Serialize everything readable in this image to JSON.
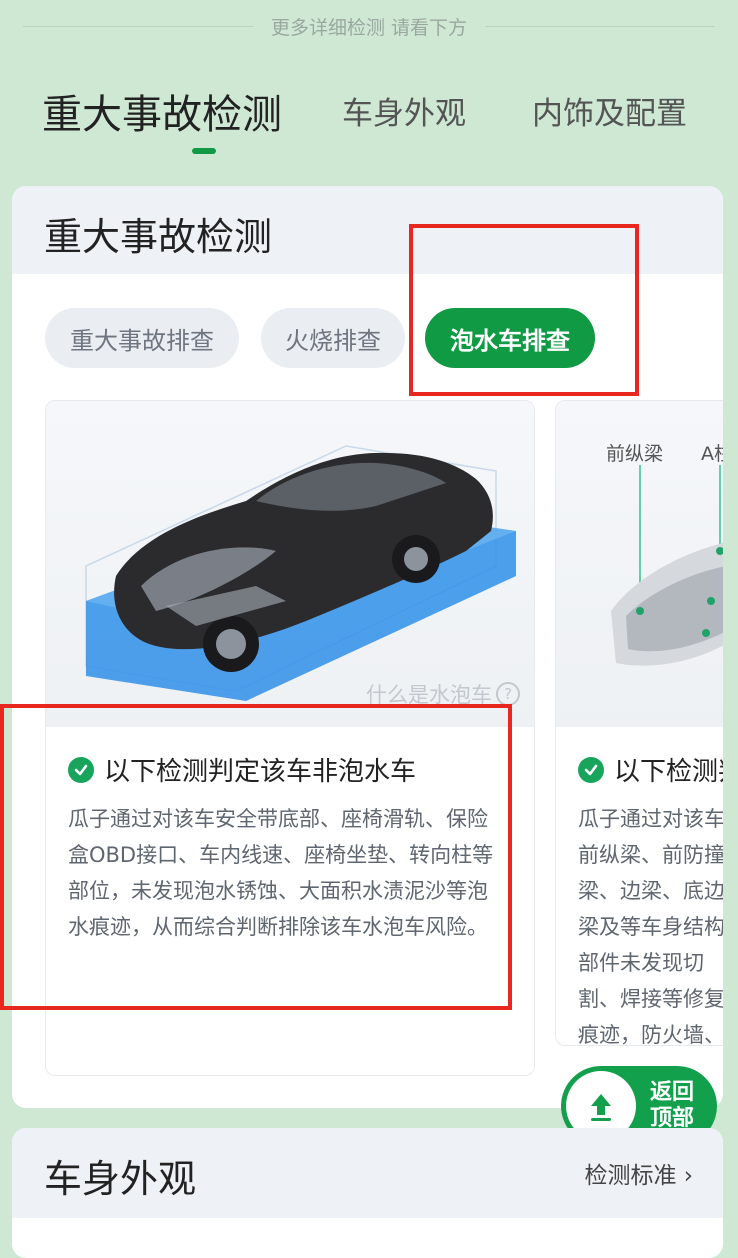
{
  "divider": {
    "text": "更多详细检测 请看下方"
  },
  "top_tabs": [
    {
      "label": "重大事故检测"
    },
    {
      "label": "车身外观"
    },
    {
      "label": "内饰及配置"
    }
  ],
  "section": {
    "title": "重大事故检测",
    "pills": [
      {
        "label": "重大事故排查"
      },
      {
        "label": "火烧排查"
      },
      {
        "label": "泡水车排查"
      }
    ],
    "flood_panel": {
      "help_link": "什么是水泡车",
      "result_title": "以下检测判定该车非泡水车",
      "description": "瓜子通过对该车安全带底部、座椅滑轨、保险盒OBD接口、车内线速、座椅坐垫、转向柱等部位，未发现泡水锈蚀、大面积水渍泥沙等泡水痕迹，从而综合判断排除该车水泡车风险。"
    },
    "structure_panel": {
      "labels": [
        "前纵梁",
        "A柱"
      ],
      "result_title": "以下检测判定该车非事故车",
      "description": "瓜子通过对该车前纵梁、前防撞梁、边梁、底边梁及等车身结构部件未发现切割、焊接等修复痕迹，防火墙、后围板等车身结构部件，未发现切割、焊接等修复痕迹，该车不存在严重结构损伤的重大事故风险。"
    }
  },
  "back_to_top": {
    "label": "返回顶部"
  },
  "next_section": {
    "title": "车身外观",
    "link": "检测标准 ›"
  },
  "colors": {
    "accent_green": "#0f9a43",
    "highlight_red": "#e8281e",
    "page_bg": "#cfe8d4"
  }
}
